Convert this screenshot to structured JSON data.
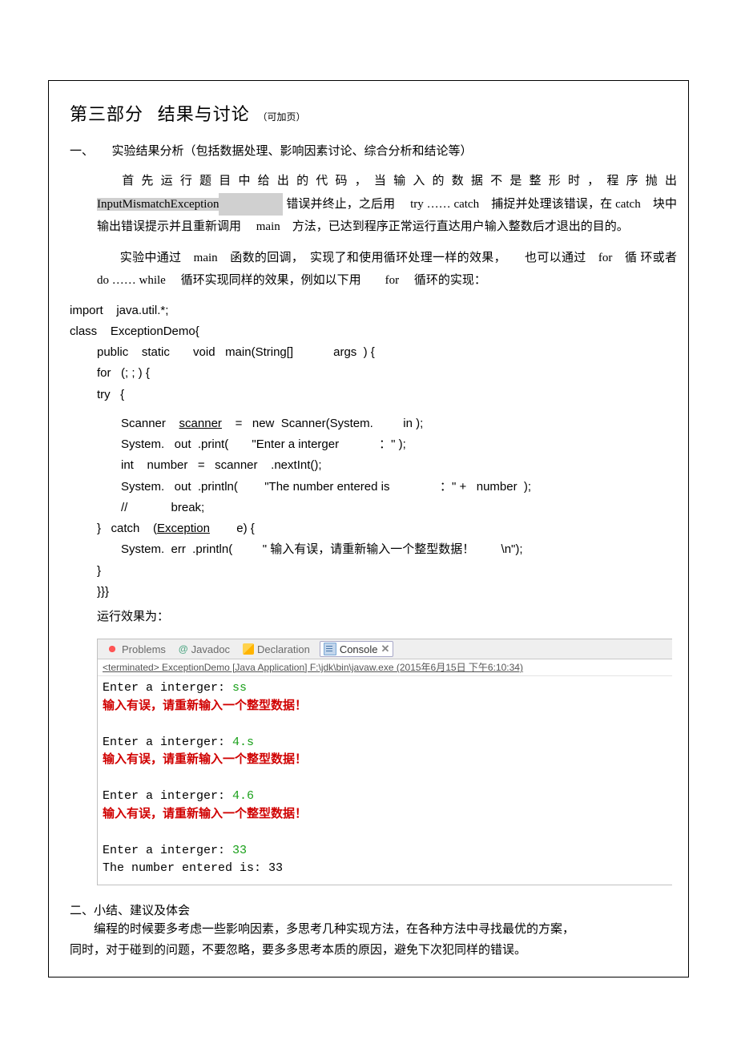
{
  "title": {
    "part": "第三部分",
    "name": "结果与讨论",
    "note": "（可加页）"
  },
  "section1": {
    "heading": "一、　　实验结果分析（包括数据处理、影响因素讨论、综合分析和结论等）",
    "p1a": "首 先 运 行 题 目 中 给 出 的 代 码 ， 当 输 入 的 数 据 不 是 整 形 时 ， 程 序 抛 出",
    "hl1": "InputMismatchException",
    "p1b": "错误并终止，之后用　 try …… catch　捕捉并处理该错误，在",
    "p1c": "catch　块中输出错误提示并且重新调用　 main　方法，已达到程序正常运行直达用户输入整数后才退出的目的。",
    "p2a": "实验中通过　main　函数的回调，　实现了和使用循环处理一样的效果，　　也可以通过　for　循",
    "p2b": "环或者　do …… while　 循环实现同样的效果，例如以下用　　for　 循环的实现："
  },
  "code": {
    "l1": "import    java.util.*;",
    "l2": "class    ExceptionDemo{",
    "l3": "public    static       void   main(String[]            args  ) {",
    "l4": "for   (; ; ) {",
    "l5": "try   {",
    "l6a": "Scanner    ",
    "l6u": "scanner",
    "l6b": "    =   new  Scanner(System.         in );",
    "l7": "System.   out  .print(       \"Enter a interger            ：\" );",
    "l8": "int    number   =   scanner    .nextInt();",
    "l9": "System.   out  .println(        \"The number entered is               ：\" +   number  );",
    "l10": "//             break;",
    "l11a": "}   catch    (",
    "l11u": "Exception",
    "l11b": "        e) {",
    "l12": "System.  err  .println(         \" 输入有误，请重新输入一个整型数据！        \\n\");",
    "l13": "}",
    "l14": "}}}"
  },
  "runlabel": "运行效果为：",
  "console": {
    "tabs": {
      "problems": "Problems",
      "javadoc": "Javadoc",
      "declaration": "Declaration",
      "console": "Console"
    },
    "terminated": "<terminated> ExceptionDemo [Java Application] F:\\jdk\\bin\\javaw.exe (2015年6月15日 下午6:10:34)",
    "lines": [
      {
        "t": "Enter a interger: ",
        "c": "norm",
        "after": {
          "t": "ss",
          "c": "in"
        }
      },
      {
        "t": "输入有误，请重新输入一个整型数据！",
        "c": "err"
      },
      {
        "t": "",
        "c": "norm"
      },
      {
        "t": "Enter a interger: ",
        "c": "norm",
        "after": {
          "t": "4.s",
          "c": "in"
        }
      },
      {
        "t": "输入有误，请重新输入一个整型数据！",
        "c": "err"
      },
      {
        "t": "",
        "c": "norm"
      },
      {
        "t": "Enter a interger: ",
        "c": "norm",
        "after": {
          "t": "4.6",
          "c": "in"
        }
      },
      {
        "t": "输入有误，请重新输入一个整型数据！",
        "c": "err"
      },
      {
        "t": "",
        "c": "norm"
      },
      {
        "t": "Enter a interger: ",
        "c": "norm",
        "after": {
          "t": "33",
          "c": "in"
        }
      },
      {
        "t": "The number entered is: 33",
        "c": "norm"
      }
    ]
  },
  "section2": {
    "heading": "二、小结、建议及体会",
    "p1": "　　编程的时候要多考虑一些影响因素，多思考几种实现方法，在各种方法中寻找最优的方案，",
    "p2": "同时，对于碰到的问题，不要忽略，要多多思考本质的原因，避免下次犯同样的错误。"
  }
}
